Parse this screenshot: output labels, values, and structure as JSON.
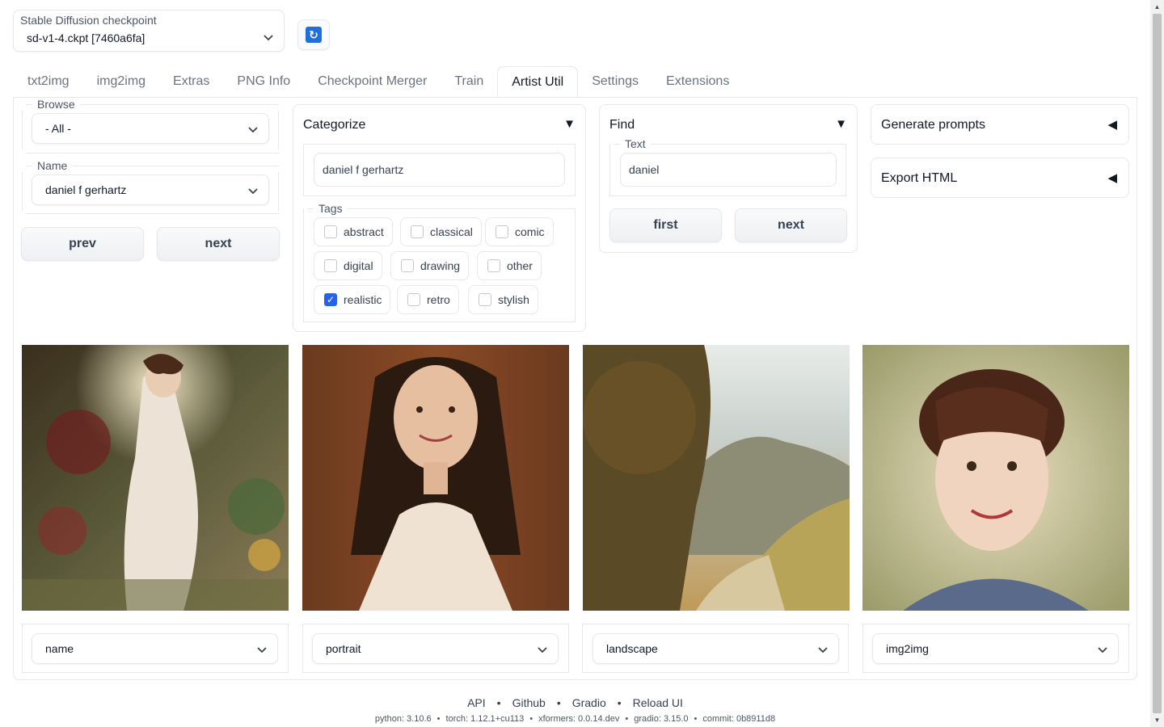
{
  "checkpoint": {
    "label": "Stable Diffusion checkpoint",
    "value": "sd-v1-4.ckpt [7460a6fa]"
  },
  "tabs": [
    "txt2img",
    "img2img",
    "Extras",
    "PNG Info",
    "Checkpoint Merger",
    "Train",
    "Artist Util",
    "Settings",
    "Extensions"
  ],
  "active_tab": "Artist Util",
  "browse": {
    "label": "Browse",
    "value": "- All -"
  },
  "name": {
    "label": "Name",
    "value": "daniel f gerhartz"
  },
  "nav": {
    "prev": "prev",
    "next": "next"
  },
  "categorize": {
    "title": "Categorize",
    "artist_value": "daniel f gerhartz",
    "tags_label": "Tags",
    "tags": [
      {
        "label": "abstract",
        "checked": false
      },
      {
        "label": "classical",
        "checked": false
      },
      {
        "label": "comic",
        "checked": false
      },
      {
        "label": "digital",
        "checked": false
      },
      {
        "label": "drawing",
        "checked": false
      },
      {
        "label": "other",
        "checked": false
      },
      {
        "label": "realistic",
        "checked": true
      },
      {
        "label": "retro",
        "checked": false
      },
      {
        "label": "stylish",
        "checked": false
      }
    ]
  },
  "find": {
    "title": "Find",
    "text_label": "Text",
    "text_value": "daniel",
    "first": "first",
    "next": "next"
  },
  "generate_prompts": "Generate prompts",
  "export_html": "Export HTML",
  "images": [
    {
      "subject": "woman in white dress among flowers",
      "select": "name"
    },
    {
      "subject": "portrait of smiling woman",
      "select": "portrait"
    },
    {
      "subject": "landscape with hills",
      "select": "landscape"
    },
    {
      "subject": "portrait of smiling girl",
      "select": "img2img"
    }
  ],
  "footer": {
    "links": [
      "API",
      "Github",
      "Gradio",
      "Reload UI"
    ],
    "versions": [
      "python: 3.10.6",
      "torch: 1.12.1+cu113",
      "xformers: 0.0.14.dev",
      "gradio: 3.15.0",
      "commit: 0b8911d8"
    ]
  },
  "colors": {
    "accent": "#2563eb",
    "refresh_icon": "#1e6fd9",
    "border": "#e5e7eb"
  }
}
